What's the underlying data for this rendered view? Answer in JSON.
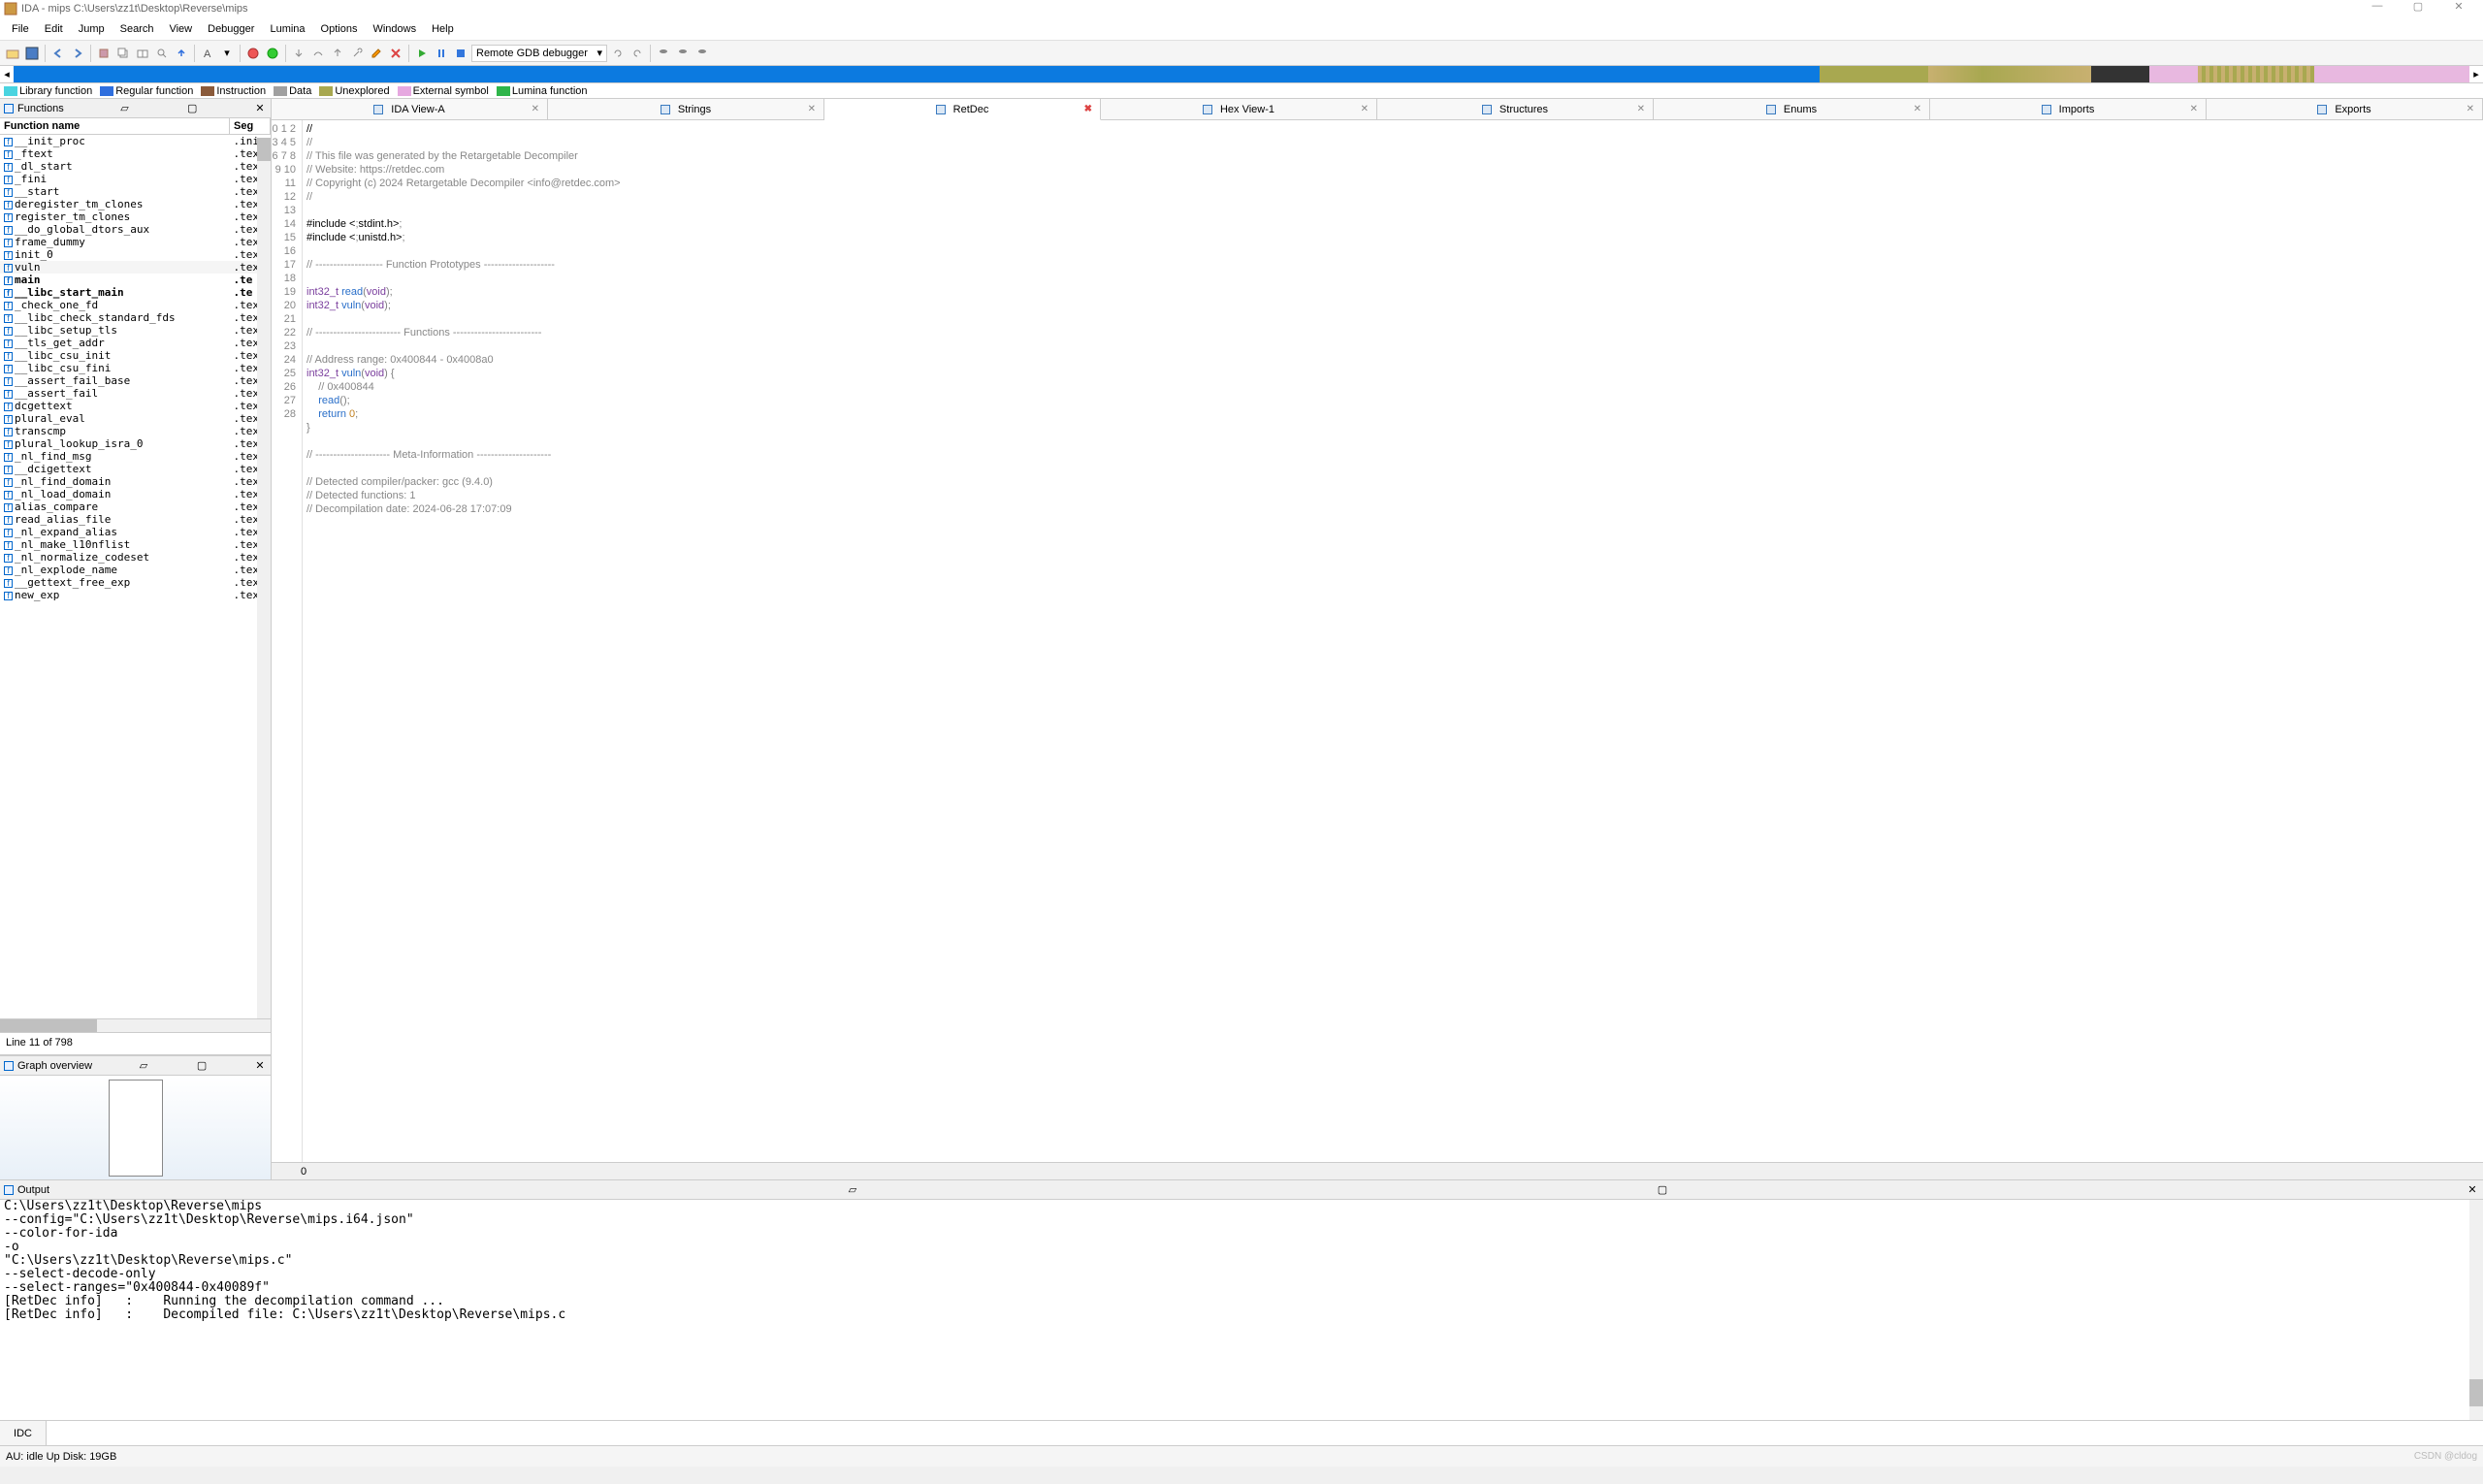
{
  "title": "IDA - mips C:\\Users\\zz1t\\Desktop\\Reverse\\mips",
  "menu": [
    "File",
    "Edit",
    "Jump",
    "Search",
    "View",
    "Debugger",
    "Lumina",
    "Options",
    "Windows",
    "Help"
  ],
  "debugger_combo": "Remote GDB debugger",
  "legend_items": [
    {
      "label": "Library function",
      "color": "#4ad4e0"
    },
    {
      "label": "Regular function",
      "color": "#2f6fde"
    },
    {
      "label": "Instruction",
      "color": "#8a5a3a"
    },
    {
      "label": "Data",
      "color": "#a0a0a0"
    },
    {
      "label": "Unexplored",
      "color": "#a8a850"
    },
    {
      "label": "External symbol",
      "color": "#e6a8e0"
    },
    {
      "label": "Lumina function",
      "color": "#2fb54a"
    }
  ],
  "functions_panel": {
    "title": "Functions",
    "col_name": "Function name",
    "col_seg": "Seg",
    "status_line": "Line 11 of 798",
    "rows": [
      {
        "name": "__init_proc",
        "seg": ".ini"
      },
      {
        "name": "_ftext",
        "seg": ".tex"
      },
      {
        "name": "_dl_start",
        "seg": ".tex"
      },
      {
        "name": "_fini",
        "seg": ".tex"
      },
      {
        "name": "__start",
        "seg": ".tex"
      },
      {
        "name": "deregister_tm_clones",
        "seg": ".tex"
      },
      {
        "name": "register_tm_clones",
        "seg": ".tex"
      },
      {
        "name": "__do_global_dtors_aux",
        "seg": ".tex"
      },
      {
        "name": "frame_dummy",
        "seg": ".tex"
      },
      {
        "name": "init_0",
        "seg": ".tex"
      },
      {
        "name": "vuln",
        "seg": ".tex",
        "selected": true
      },
      {
        "name": "main",
        "seg": ".te",
        "bold": true
      },
      {
        "name": "__libc_start_main",
        "seg": ".te",
        "bold": true
      },
      {
        "name": "_check_one_fd",
        "seg": ".tex"
      },
      {
        "name": "__libc_check_standard_fds",
        "seg": ".tex"
      },
      {
        "name": "__libc_setup_tls",
        "seg": ".tex"
      },
      {
        "name": "__tls_get_addr",
        "seg": ".tex"
      },
      {
        "name": "__libc_csu_init",
        "seg": ".tex"
      },
      {
        "name": "__libc_csu_fini",
        "seg": ".tex"
      },
      {
        "name": "__assert_fail_base",
        "seg": ".tex"
      },
      {
        "name": "__assert_fail",
        "seg": ".tex"
      },
      {
        "name": "dcgettext",
        "seg": ".tex"
      },
      {
        "name": "plural_eval",
        "seg": ".tex"
      },
      {
        "name": "transcmp",
        "seg": ".tex"
      },
      {
        "name": "plural_lookup_isra_0",
        "seg": ".tex"
      },
      {
        "name": "_nl_find_msg",
        "seg": ".tex"
      },
      {
        "name": "__dcigettext",
        "seg": ".tex"
      },
      {
        "name": "_nl_find_domain",
        "seg": ".tex"
      },
      {
        "name": "_nl_load_domain",
        "seg": ".tex"
      },
      {
        "name": "alias_compare",
        "seg": ".tex"
      },
      {
        "name": "read_alias_file",
        "seg": ".tex"
      },
      {
        "name": "_nl_expand_alias",
        "seg": ".tex"
      },
      {
        "name": "_nl_make_l10nflist",
        "seg": ".tex"
      },
      {
        "name": "_nl_normalize_codeset",
        "seg": ".tex"
      },
      {
        "name": "_nl_explode_name",
        "seg": ".tex"
      },
      {
        "name": "__gettext_free_exp",
        "seg": ".tex"
      },
      {
        "name": "new_exp",
        "seg": ".tex"
      }
    ]
  },
  "graph_title": "Graph overview",
  "tabs": [
    {
      "label": "IDA View-A"
    },
    {
      "label": "Strings"
    },
    {
      "label": "RetDec",
      "active": true
    },
    {
      "label": "Hex View-1"
    },
    {
      "label": "Structures"
    },
    {
      "label": "Enums"
    },
    {
      "label": "Imports"
    },
    {
      "label": "Exports"
    }
  ],
  "code_lines": [
    "//",
    "// This file was generated by the Retargetable Decompiler",
    "// Website: https://retdec.com",
    "// Copyright (c) 2024 Retargetable Decompiler <info@retdec.com>",
    "//",
    "",
    "#include <stdint.h>",
    "#include <unistd.h>",
    "",
    "// ------------------- Function Prototypes --------------------",
    "",
    "int32_t read(void);",
    "int32_t vuln(void);",
    "",
    "// ------------------------ Functions -------------------------",
    "",
    "// Address range: 0x400844 - 0x4008a0",
    "int32_t vuln(void) {",
    "    // 0x400844",
    "    read();",
    "    return 0;",
    "}",
    "",
    "// --------------------- Meta-Information ---------------------",
    "",
    "// Detected compiler/packer: gcc (9.4.0)",
    "// Detected functions: 1",
    "// Decompilation date: 2024-06-28 17:07:09"
  ],
  "code_pos": "0",
  "output_title": "Output",
  "output_lines": [
    "C:\\Users\\zz1t\\Desktop\\Reverse\\mips",
    "--config=\"C:\\Users\\zz1t\\Desktop\\Reverse\\mips.i64.json\"",
    "--color-for-ida",
    "-o",
    "\"C:\\Users\\zz1t\\Desktop\\Reverse\\mips.c\"",
    "--select-decode-only",
    "--select-ranges=\"0x400844-0x40089f\"",
    "[RetDec info]   :    Running the decompilation command ...",
    "[RetDec info]   :    Decompiled file: C:\\Users\\zz1t\\Desktop\\Reverse\\mips.c"
  ],
  "idc_label": "IDC",
  "status": {
    "left": "AU:  idle   Up   Disk: 19GB",
    "right": "CSDN @cldog"
  }
}
